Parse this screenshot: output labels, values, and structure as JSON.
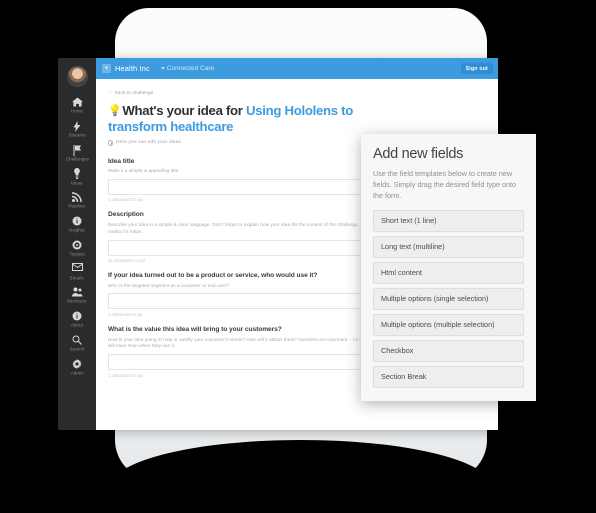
{
  "app": {
    "topbar": {
      "plus_icon": "plus-icon",
      "brand": "Health Inc",
      "nav_item": "Connected Care",
      "signout_label": "Sign out",
      "accent_color": "#3d9be0"
    },
    "sidebar": {
      "avatar": "user-avatar",
      "items": [
        {
          "icon": "home-icon",
          "label": "Home"
        },
        {
          "icon": "bolt-icon",
          "label": "Streams"
        },
        {
          "icon": "flag-icon",
          "label": "Challenges"
        },
        {
          "icon": "bulb-icon",
          "label": "Ideas"
        },
        {
          "icon": "rss-icon",
          "label": "Pipeline"
        },
        {
          "icon": "info-icon",
          "label": "Insights"
        },
        {
          "icon": "target-icon",
          "label": "Targets"
        },
        {
          "icon": "envelope-icon",
          "label": "Emails"
        },
        {
          "icon": "members-icon",
          "label": "Members"
        },
        {
          "icon": "about-icon",
          "label": "About"
        },
        {
          "icon": "search-icon",
          "label": "Search"
        },
        {
          "icon": "gear-icon",
          "label": "Admin"
        }
      ]
    },
    "page": {
      "back_link": "back to challenge",
      "back_arrow": "←",
      "title_icon": "lightbulb-icon",
      "title_prefix": "What's your idea for ",
      "title_highlight": "Using Hololens to transform healthcare",
      "subtitle": "Here you can edit your ideas",
      "highlight_color": "#3d9be0"
    },
    "form": {
      "fields": [
        {
          "label": "Idea title",
          "help": "Make it a simple & appealing title.",
          "value": "",
          "counter": "1 characters to go"
        },
        {
          "label": "Description",
          "help": "Describe your idea in a simple & clear language. Don't forget to explain how your idea fits the context of the challenge. Use media if it helps.",
          "value": "",
          "counter": "46 characters to go"
        },
        {
          "label": "If your idea turned out to be a product or service, who would use it?",
          "help": "Who is the targeted segment as a customer or end user?",
          "value": "",
          "counter": "1 characters to go"
        },
        {
          "label": "What is the value this idea will bring to your customers?",
          "help": "How is your idea going to help or satisfy your customer's needs? How will it attract them? Numbers are important – i.e.: they will save 3min when they use it.",
          "value": "",
          "counter": "1 characters to go"
        }
      ]
    }
  },
  "panel": {
    "title": "Add new fields",
    "description": "Use the field templates below to create new fields. Simply drag the desired field type onto the form.",
    "templates": [
      "Short text (1 line)",
      "Long text (multiline)",
      "Html content",
      "Multiple options (single selection)",
      "Multiple options (multiple selection)",
      "Checkbox",
      "Section Break"
    ]
  }
}
